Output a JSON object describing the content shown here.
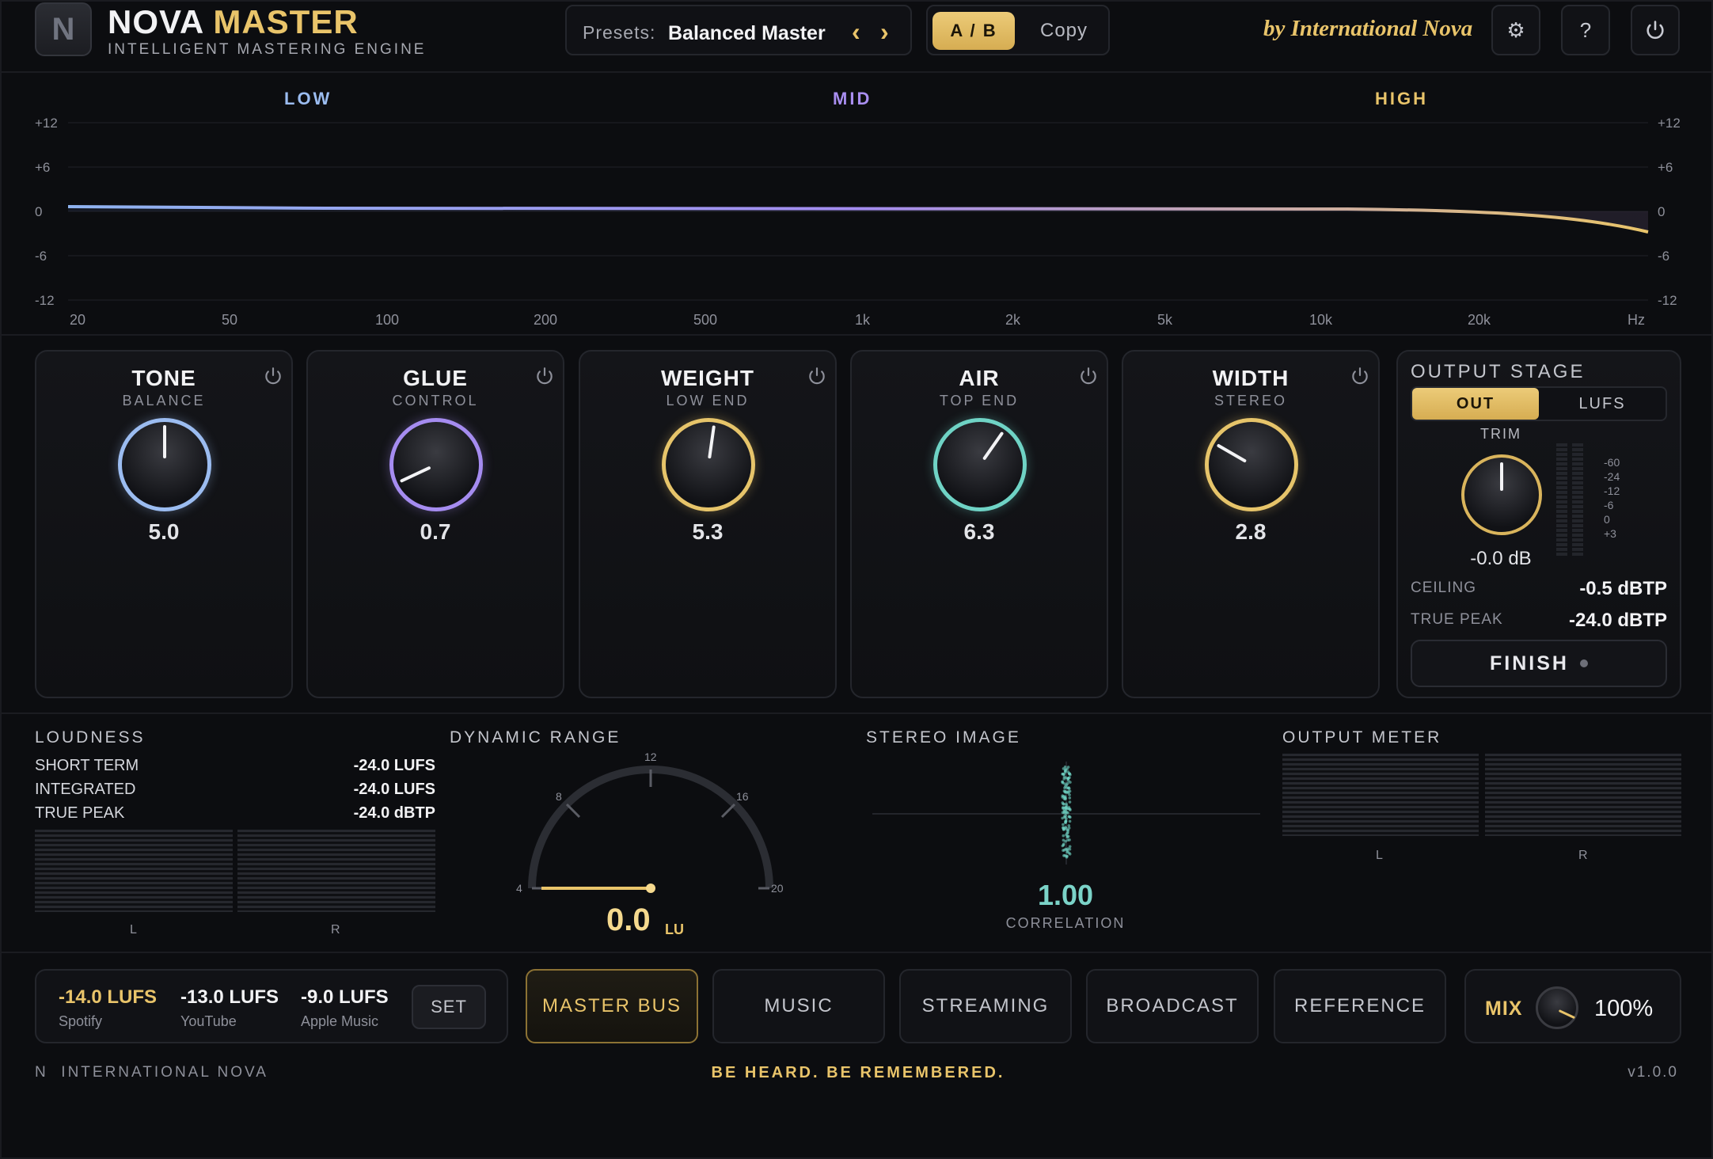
{
  "header": {
    "logo_letter": "N",
    "brand_part1": "NOVA",
    "brand_part2": "MASTER",
    "subtitle": "INTELLIGENT MASTERING ENGINE",
    "preset_label": "Presets:",
    "preset_name": "Balanced Master",
    "prev_glyph": "‹",
    "next_glyph": "›",
    "ab_label": "A / B",
    "copy_label": "Copy",
    "byline": "by International Nova",
    "settings_glyph": "⚙",
    "help_glyph": "?",
    "power_glyph": "⏻"
  },
  "eq": {
    "bands": [
      "LOW",
      "MID",
      "HIGH"
    ],
    "band_colors": [
      "#9bbcf0",
      "#a98ef0",
      "#e9c46a"
    ],
    "y_labels": [
      "+12",
      "+6",
      "0",
      "-6",
      "-12"
    ],
    "x_labels": [
      "20",
      "50",
      "100",
      "200",
      "500",
      "1k",
      "2k",
      "5k",
      "10k",
      "20k",
      "Hz"
    ]
  },
  "modules": [
    {
      "title": "TONE",
      "sub": "BALANCE",
      "value": "5.0",
      "color": "#9bbcf0",
      "angle": 0
    },
    {
      "title": "GLUE",
      "sub": "CONTROL",
      "value": "0.7",
      "color": "#a58cf0",
      "angle": -115
    },
    {
      "title": "WEIGHT",
      "sub": "LOW END",
      "value": "5.3",
      "color": "#e6c46a",
      "angle": 8
    },
    {
      "title": "AIR",
      "sub": "TOP END",
      "value": "6.3",
      "color": "#6fd3c5",
      "angle": 35
    },
    {
      "title": "WIDTH",
      "sub": "STEREO",
      "value": "2.8",
      "color": "#e6c46a",
      "angle": -60
    }
  ],
  "output_stage": {
    "title": "OUTPUT STAGE",
    "tab_out": "OUT",
    "tab_lufs": "LUFS",
    "trim_label": "TRIM",
    "trim_value": "-0.0 dB",
    "meter_scale": [
      "-60",
      "-24",
      "-12",
      "-6",
      "0",
      "+3"
    ],
    "ceiling_label": "CEILING",
    "ceiling_value": "-0.5 dBTP",
    "truepeak_label": "TRUE PEAK",
    "truepeak_value": "-24.0 dBTP",
    "finish_label": "FINISH"
  },
  "loudness": {
    "title": "LOUDNESS",
    "rows": [
      {
        "label": "SHORT TERM",
        "value": "-24.0 LUFS"
      },
      {
        "label": "INTEGRATED",
        "value": "-24.0 LUFS"
      },
      {
        "label": "TRUE PEAK",
        "value": "-24.0 dBTP"
      }
    ],
    "left": "L",
    "right": "R"
  },
  "dynamic_range": {
    "title": "DYNAMIC RANGE",
    "scale": [
      "4",
      "8",
      "12",
      "16",
      "20"
    ],
    "value": "0.0",
    "unit": "LU"
  },
  "stereo_image": {
    "title": "STEREO IMAGE",
    "correlation": "1.00",
    "correlation_label": "CORRELATION"
  },
  "output_meter": {
    "title": "OUTPUT METER",
    "left": "L",
    "right": "R"
  },
  "targets": [
    {
      "value": "-14.0 LUFS",
      "label": "Spotify",
      "color": "#e9c46a"
    },
    {
      "value": "-13.0 LUFS",
      "label": "YouTube",
      "color": "#f2f2f4"
    },
    {
      "value": "-9.0 LUFS",
      "label": "Apple Music",
      "color": "#f2f2f4"
    }
  ],
  "set_label": "SET",
  "modes": [
    "MASTER BUS",
    "MUSIC",
    "STREAMING",
    "BROADCAST",
    "REFERENCE"
  ],
  "active_mode": "MASTER BUS",
  "mix": {
    "label": "MIX",
    "value": "100%"
  },
  "footer": {
    "logo_letter": "N",
    "company": "INTERNATIONAL NOVA",
    "tagline": "BE HEARD. BE REMEMBERED.",
    "version": "v1.0.0"
  }
}
